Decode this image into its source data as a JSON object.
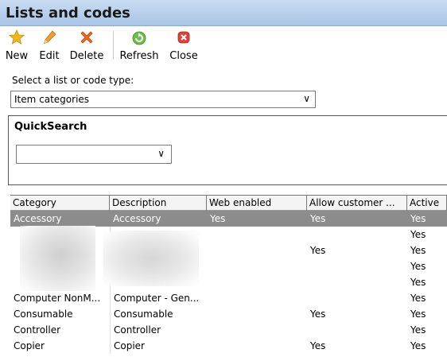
{
  "window": {
    "title": "Lists and codes"
  },
  "toolbar": {
    "buttons": [
      {
        "label": "New",
        "icon": "star-icon",
        "color": "#f0b020"
      },
      {
        "label": "Edit",
        "icon": "pencil-icon",
        "color": "#e08a1e"
      },
      {
        "label": "Delete",
        "icon": "x-icon",
        "color": "#e8641e"
      },
      {
        "label": "Refresh",
        "icon": "refresh-icon",
        "color": "#4caf2e"
      },
      {
        "label": "Close",
        "icon": "close-icon",
        "color": "#d9443a"
      }
    ]
  },
  "type_select": {
    "label": "Select a list or code type:",
    "value": "Item categories"
  },
  "quicksearch": {
    "title": "QuickSearch",
    "value": ""
  },
  "grid": {
    "columns": [
      "Category",
      "Description",
      "Web enabled",
      "Allow customer ...",
      "Active"
    ],
    "rows": [
      [
        "Accessory",
        "Accessory",
        "Yes",
        "Yes",
        "Yes"
      ],
      [
        "",
        "",
        "",
        "",
        "Yes"
      ],
      [
        "",
        "",
        "",
        "Yes",
        "Yes"
      ],
      [
        "",
        "",
        "",
        "",
        "Yes"
      ],
      [
        "",
        "",
        "",
        "",
        "Yes"
      ],
      [
        "Computer NonM...",
        "Computer - Gen...",
        "",
        "",
        "Yes"
      ],
      [
        "Consumable",
        "Consumable",
        "",
        "Yes",
        "Yes"
      ],
      [
        "Controller",
        "Controller",
        "",
        "",
        "Yes"
      ],
      [
        "Copier",
        "Copier",
        "",
        "Yes",
        "Yes"
      ]
    ],
    "selected_row": 0
  }
}
